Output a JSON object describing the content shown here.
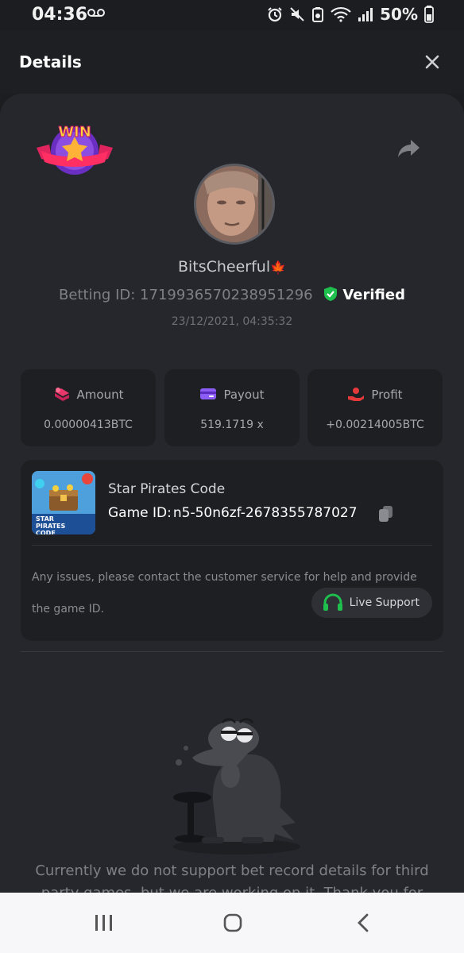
{
  "status_bar": {
    "time": "04:36",
    "battery": "50%"
  },
  "header": {
    "title": "Details"
  },
  "badge": {
    "text": "WIN"
  },
  "user": {
    "name": "BitsCheerful",
    "emoji": "🍁",
    "betting_id": "Betting ID: 1719936570238951296",
    "verified": "Verified",
    "datetime": "23/12/2021, 04:35:32"
  },
  "stats": [
    {
      "label": "Amount",
      "value": "0.00000413BTC",
      "icon": "money-icon",
      "color": "#e8386b"
    },
    {
      "label": "Payout",
      "value": "519.1719 x",
      "icon": "wallet-icon",
      "color": "#8b5cf6"
    },
    {
      "label": "Profit",
      "value": "+0.00214005BTC",
      "icon": "hand-coin-icon",
      "color": "#e53a3a"
    }
  ],
  "game": {
    "name": "Star Pirates Code",
    "id_label": "Game ID:",
    "id_value": "n5-50n6zf-2678355787027",
    "thumb_text": "STAR PIRATES CODE",
    "help_text": "Any issues, please contact the customer service for help and provide the game ID.",
    "support_label": "Live Support"
  },
  "notice": "Currently we do not support bet record details for third party games, but we are working on it. Thank you for",
  "colors": {
    "accent_green": "#1fbf4d",
    "background": "#1c1d21",
    "sheet": "#26272c",
    "card": "#1e1f23"
  }
}
